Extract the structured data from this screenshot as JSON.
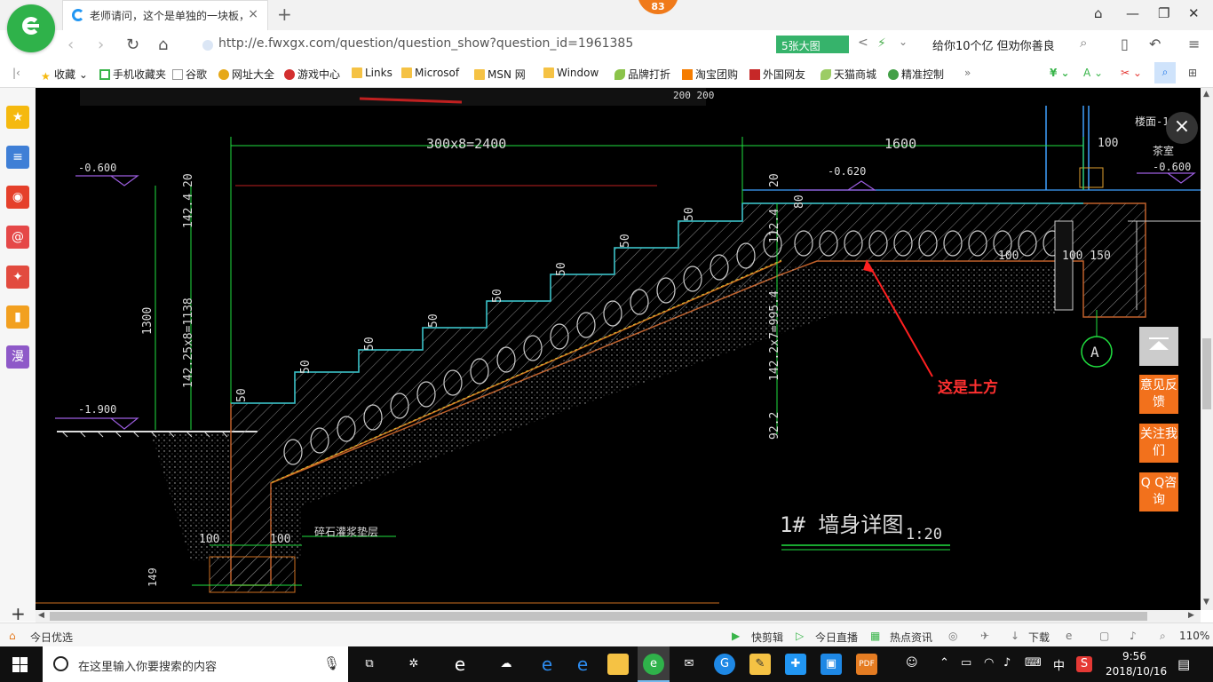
{
  "browser": {
    "badge_count": "83",
    "tab": {
      "title": "老师请问，这个是单独的一块板，",
      "close": "×"
    },
    "new_tab": "+",
    "url": "http://e.fwxgx.com/question/question_show?question_id=1961385",
    "big_image_button": "5张大图",
    "search_text": "给你10个亿 但劝你善良"
  },
  "bookmarks": [
    {
      "label": "收藏",
      "icon": "star-icon"
    },
    {
      "label": "手机收藏夹",
      "icon": "phone-icon"
    },
    {
      "label": "谷歌",
      "icon": "page-icon"
    },
    {
      "label": "网址大全",
      "icon": "ie-icon"
    },
    {
      "label": "游戏中心",
      "icon": "game-icon"
    },
    {
      "label": "Links",
      "icon": "folder-icon"
    },
    {
      "label": "Microsof",
      "icon": "folder-icon"
    },
    {
      "label": "MSN 网",
      "icon": "folder-icon"
    },
    {
      "label": "Window",
      "icon": "folder-icon"
    },
    {
      "label": "品牌打折",
      "icon": "leaf-icon"
    },
    {
      "label": "淘宝团购",
      "icon": "taobao-icon"
    },
    {
      "label": "外国网友",
      "icon": "flag-icon"
    },
    {
      "label": "天猫商城",
      "icon": "leaf-icon"
    },
    {
      "label": "精准控制",
      "icon": "chat-icon"
    }
  ],
  "bookmarks_more": "»",
  "sidebar": [
    {
      "name": "favorites-star-icon",
      "glyph": "★",
      "color": "#f5b90f"
    },
    {
      "name": "news-panel-icon",
      "glyph": "≡",
      "color": "#3f7fd6"
    },
    {
      "name": "weibo-icon",
      "glyph": "◉",
      "color": "#e5402b"
    },
    {
      "name": "mail-icon",
      "glyph": "@",
      "color": "#e54848"
    },
    {
      "name": "game-controller-icon",
      "glyph": "✦",
      "color": "#e24b3f"
    },
    {
      "name": "reader-book-icon",
      "glyph": "▮",
      "color": "#f2a020"
    },
    {
      "name": "comic-icon",
      "glyph": "漫",
      "color": "#8e59c8"
    }
  ],
  "drawing": {
    "dim_top_left": "300x8=2400",
    "dim_top_right": "1600",
    "elev_left_top": "-0.600",
    "elev_mid": "-0.620",
    "elev_right": "-0.600",
    "elev_bottom": "-1.900",
    "right_top_label": "楼面-1",
    "right_second_label": "茶室",
    "dim_100_right": "100",
    "dim_100_mid": "100",
    "dim_100_150": "100 150",
    "dim_20_left": "20",
    "dim_1424": "142.4",
    "dim_1300": "1300",
    "dim_114225": "142.25x8=1138",
    "dim_20_mid": "20",
    "dim_80": "80",
    "dim_1124": "112.4",
    "dim_9954": "142.2x7=995.4",
    "dim_922": "92.2",
    "step_label": "50",
    "axis_label": "A",
    "gravel_label": "碎石灌浆垫层",
    "foot_dim_left": "100",
    "foot_dim_right": "100",
    "foot_dim_height": "149",
    "title_main": "1# 墙身详图",
    "title_scale": "1:20",
    "top_partial": "200 200"
  },
  "overlay": {
    "close": "×",
    "annotation": "这是土方",
    "feedback": "意见反馈",
    "follow": "关注我们",
    "qq": "Q Q咨询"
  },
  "statusbar": {
    "left": "今日优选",
    "quick_clip": "快剪辑",
    "live": "今日直播",
    "hot_news": "热点资讯",
    "download": "下载",
    "zoom": "110%"
  },
  "taskbar": {
    "search_placeholder": "在这里输入你要搜索的内容",
    "ime": "中",
    "time": "9:56",
    "date": "2018/10/16"
  },
  "colors": {
    "brand_green": "#2fb24a",
    "accent_orange": "#f2711c",
    "annotation_red": "#ff3030",
    "cad_background": "#000000"
  }
}
